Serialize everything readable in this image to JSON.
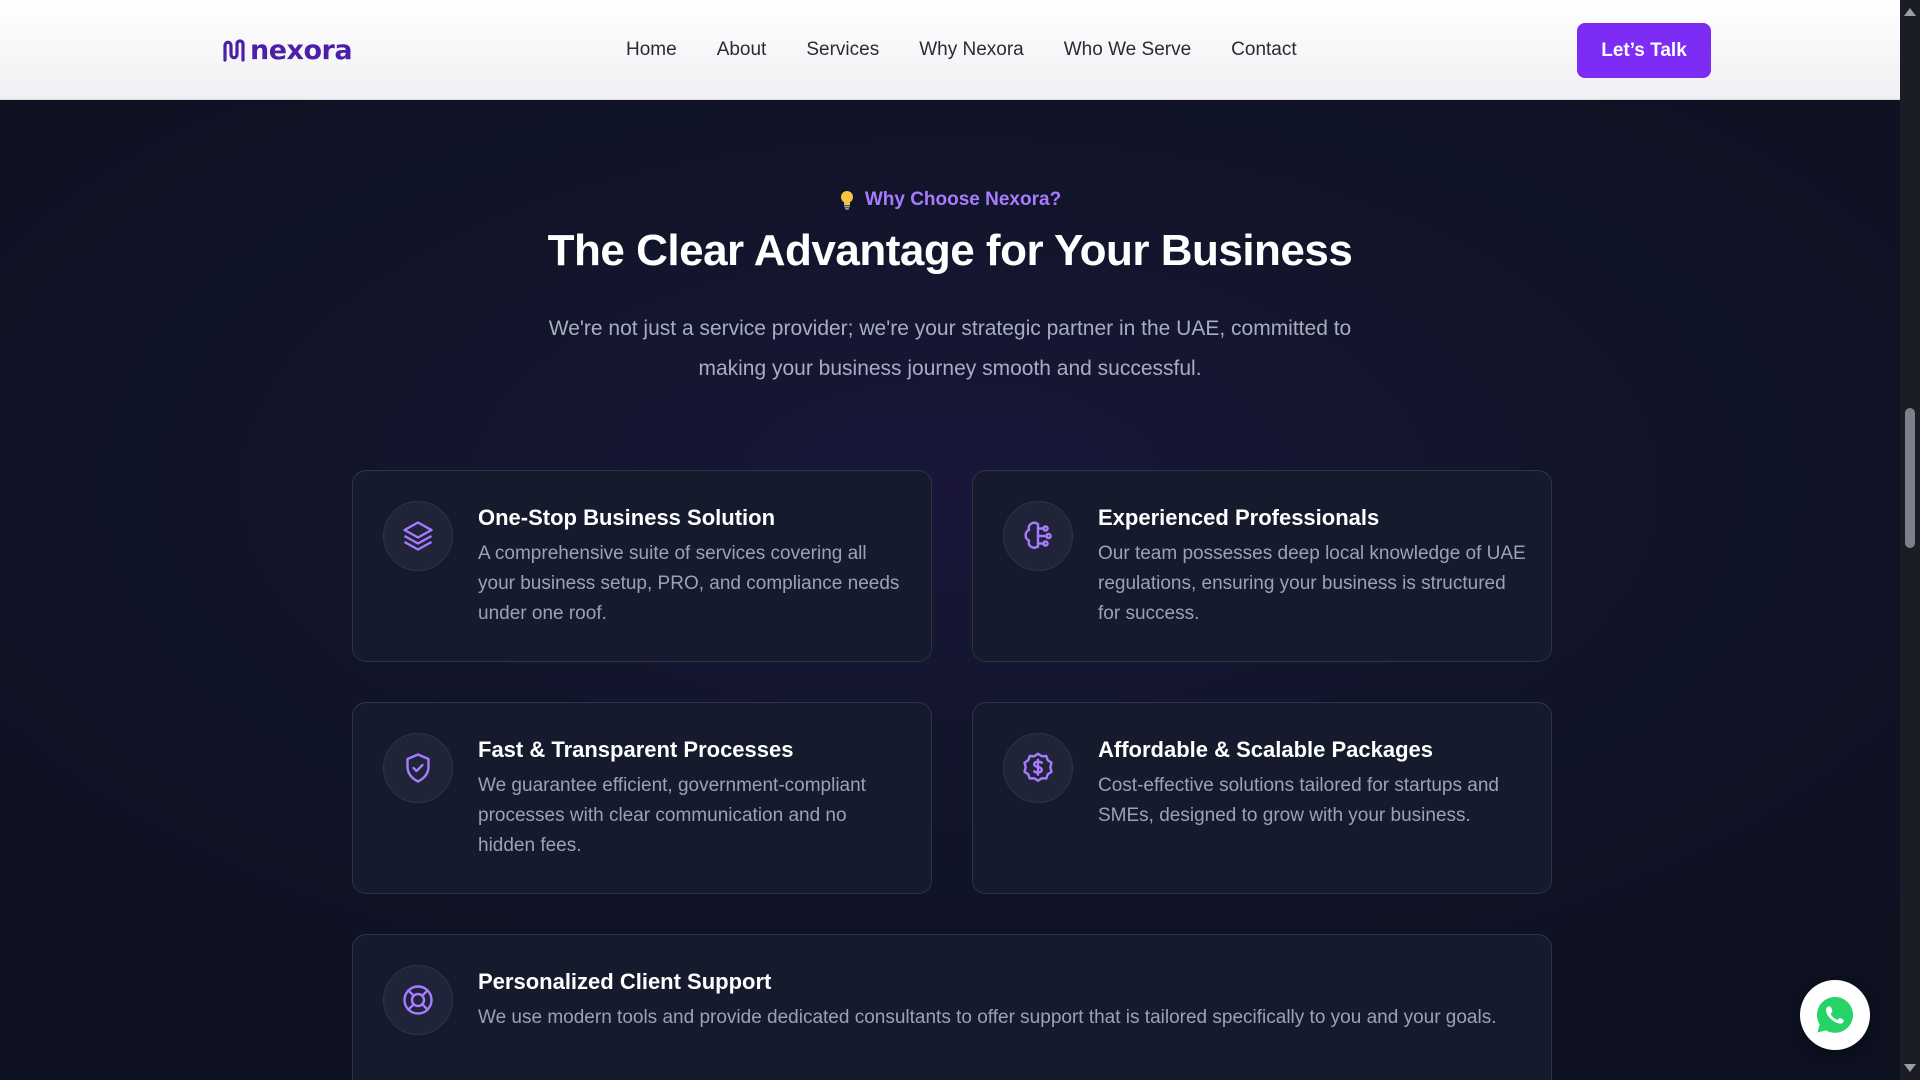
{
  "header": {
    "logo_text": "nexora",
    "logo_icon": "nexora-mark-icon",
    "nav": [
      {
        "label": "Home"
      },
      {
        "label": "About"
      },
      {
        "label": "Services"
      },
      {
        "label": "Why Nexora"
      },
      {
        "label": "Who We Serve"
      },
      {
        "label": "Contact"
      }
    ],
    "cta_label": "Let’s Talk"
  },
  "section": {
    "eyebrow_icon": "lightbulb-icon",
    "eyebrow": "Why Choose Nexora?",
    "title": "The Clear Advantage for Your Business",
    "subtitle": "We're not just a service provider; we're your strategic partner in the UAE, committed to making your business journey smooth and successful.",
    "cards": [
      {
        "icon": "layers-icon",
        "title": "One-Stop Business Solution",
        "description": "A comprehensive suite of services covering all your business setup, PRO, and compliance needs under one roof."
      },
      {
        "icon": "brain-icon",
        "title": "Experienced Professionals",
        "description": "Our team possesses deep local knowledge of UAE regulations, ensuring your business is structured for success."
      },
      {
        "icon": "shield-check-icon",
        "title": "Fast & Transparent Processes",
        "description": "We guarantee efficient, government-compliant processes with clear communication and no hidden fees."
      },
      {
        "icon": "dollar-badge-icon",
        "title": "Affordable & Scalable Packages",
        "description": "Cost-effective solutions tailored for startups and SMEs, designed to grow with your business."
      },
      {
        "icon": "lifebuoy-icon",
        "title": "Personalized Client Support",
        "description": "We use modern tools and provide dedicated consultants to offer support that is tailored specifically to you and your goals."
      }
    ]
  },
  "floating": {
    "whatsapp_icon": "whatsapp-icon"
  },
  "colors": {
    "accent": "#7c2cf5",
    "eyebrow": "#a77bff",
    "background": "#0f1322",
    "card": "#151a2d"
  }
}
